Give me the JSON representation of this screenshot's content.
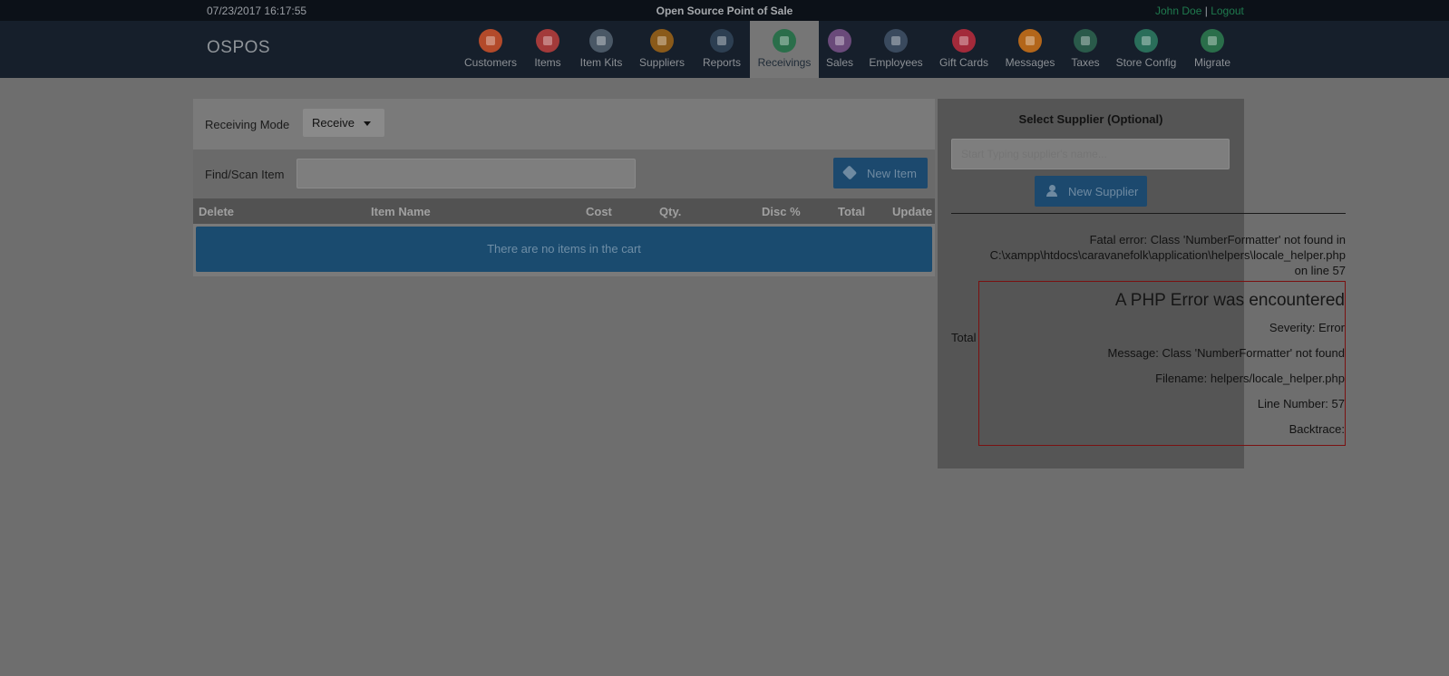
{
  "topbar": {
    "datetime": "07/23/2017 16:17:55",
    "app_title": "Open Source Point of Sale",
    "user_name": "John Doe",
    "separator": "|",
    "logout_label": "Logout"
  },
  "navbar": {
    "brand": "OSPOS",
    "items": [
      {
        "label": "Customers",
        "icon": "customers-icon",
        "color": "#b34a2a"
      },
      {
        "label": "Items",
        "icon": "items-icon",
        "color": "#a33a3a"
      },
      {
        "label": "Item Kits",
        "icon": "item-kits-icon",
        "color": "#4a5866"
      },
      {
        "label": "Suppliers",
        "icon": "suppliers-icon",
        "color": "#8a5a1a"
      },
      {
        "label": "Reports",
        "icon": "reports-icon",
        "color": "#2d3f52"
      },
      {
        "label": "Receivings",
        "icon": "receivings-icon",
        "color": "#2a6e4a"
      },
      {
        "label": "Sales",
        "icon": "sales-icon",
        "color": "#6a4a7a"
      },
      {
        "label": "Employees",
        "icon": "employees-icon",
        "color": "#3a4a5e"
      },
      {
        "label": "Gift Cards",
        "icon": "gift-cards-icon",
        "color": "#a32a3a"
      },
      {
        "label": "Messages",
        "icon": "messages-icon",
        "color": "#b3661a"
      },
      {
        "label": "Taxes",
        "icon": "taxes-icon",
        "color": "#2a5a4a"
      },
      {
        "label": "Store Config",
        "icon": "store-config-icon",
        "color": "#2a6e5a"
      },
      {
        "label": "Migrate",
        "icon": "migrate-icon",
        "color": "#2a6e4a"
      }
    ],
    "active": "Receivings"
  },
  "receiving": {
    "mode_label": "Receiving Mode",
    "mode_value": "Receive",
    "find_label": "Find/Scan Item",
    "find_value": "",
    "new_item_label": "New Item",
    "columns": [
      "Delete",
      "Item Name",
      "Cost",
      "Qty.",
      "Disc %",
      "Total",
      "Update"
    ],
    "empty_message": "There are no items in the cart"
  },
  "supplier": {
    "title": "Select Supplier (Optional)",
    "placeholder": "Start Typing supplier's name...",
    "new_supplier_label": "New Supplier"
  },
  "error": {
    "fatal_line1": "Fatal error: Class 'NumberFormatter' not found in",
    "fatal_line2": "C:\\xampp\\htdocs\\caravanefolk\\application\\helpers\\locale_helper.php",
    "fatal_line3": "on line 57",
    "total_label": "Total",
    "heading": "A PHP Error was encountered",
    "severity": "Severity: Error",
    "message": "Message: Class 'NumberFormatter' not found",
    "filename": "Filename: helpers/locale_helper.php",
    "line_number": "Line Number: 57",
    "backtrace": "Backtrace:"
  },
  "colors": {
    "accent_blue": "#1c496e",
    "user_link": "#1f7a4e",
    "error_border": "#7a1010"
  }
}
